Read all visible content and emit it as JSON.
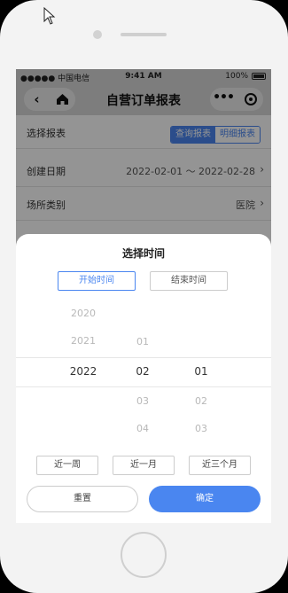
{
  "status_bar": {
    "carrier": "●●●●● 中国电信",
    "time": "9:41 AM",
    "battery": "100%"
  },
  "nav": {
    "back": "‹",
    "title": "自营订单报表",
    "more": "•••"
  },
  "form": {
    "report_label": "选择报表",
    "segment": [
      "查询报表",
      "明细报表"
    ],
    "date_label": "创建日期",
    "date_value": "2022-02-01 ～ 2022-02-28",
    "venue_label": "场所类别",
    "venue_value": "医院"
  },
  "sheet": {
    "title": "选择时间",
    "tabs": [
      "开始时间",
      "结束时间"
    ],
    "year_options": [
      "2020",
      "2021",
      "2022"
    ],
    "month_options": [
      "01",
      "02",
      "03",
      "04"
    ],
    "day_options": [
      "01",
      "02",
      "03"
    ],
    "selected": {
      "year": "2022",
      "month": "02",
      "day": "01"
    },
    "quick": [
      "近一周",
      "近一月",
      "近三个月"
    ],
    "reset": "重置",
    "confirm": "确定"
  },
  "colors": {
    "accent": "#4a86f0"
  }
}
